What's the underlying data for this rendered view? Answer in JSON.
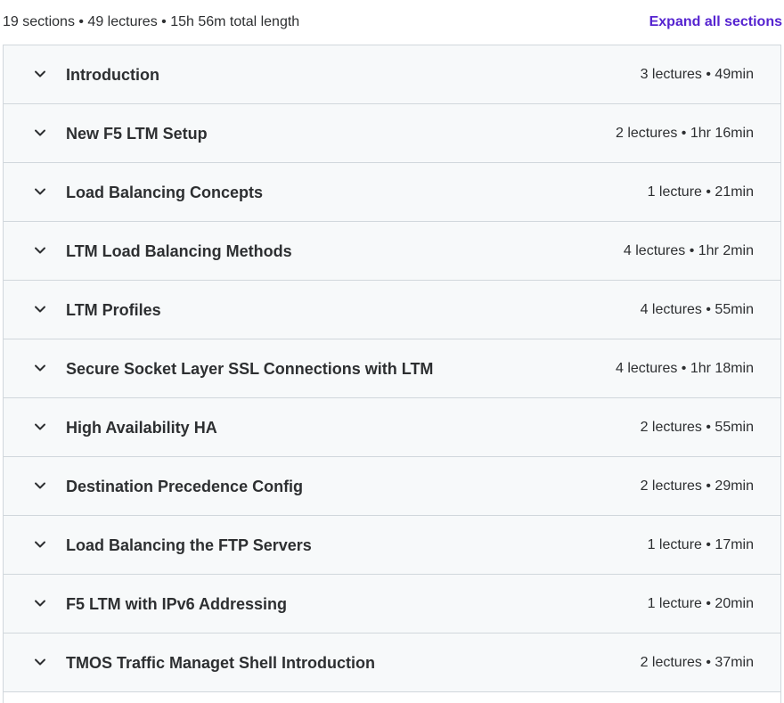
{
  "summary": "19 sections • 49 lectures • 15h 56m total length",
  "expand_all_label": "Expand all sections",
  "sections": [
    {
      "title": "Introduction",
      "meta": "3 lectures • 49min"
    },
    {
      "title": "New F5 LTM Setup",
      "meta": "2 lectures • 1hr 16min"
    },
    {
      "title": "Load Balancing Concepts",
      "meta": "1 lecture • 21min"
    },
    {
      "title": "LTM Load Balancing Methods",
      "meta": "4 lectures • 1hr 2min"
    },
    {
      "title": "LTM Profiles",
      "meta": "4 lectures • 55min"
    },
    {
      "title": "Secure Socket Layer SSL Connections with LTM",
      "meta": "4 lectures • 1hr 18min"
    },
    {
      "title": "High Availability HA",
      "meta": "2 lectures • 55min"
    },
    {
      "title": "Destination Precedence Config",
      "meta": "2 lectures • 29min"
    },
    {
      "title": "Load Balancing the FTP Servers",
      "meta": "1 lecture • 17min"
    },
    {
      "title": "F5 LTM with IPv6 Addressing",
      "meta": "1 lecture • 20min"
    },
    {
      "title": "TMOS Traffic Managet Shell Introduction",
      "meta": "2 lectures • 37min"
    }
  ],
  "icons": {
    "section_toggle": "chevron-down-icon"
  },
  "colors": {
    "accent": "#5624d0",
    "section_bg": "#f7f9fa",
    "border": "#d1d7dc",
    "text": "#2d2f31"
  }
}
